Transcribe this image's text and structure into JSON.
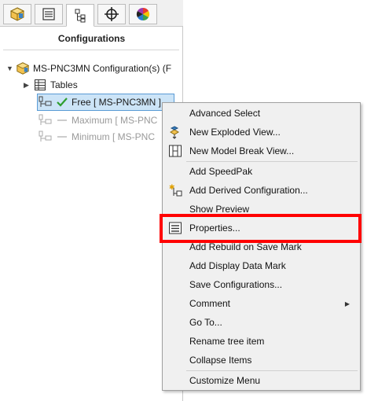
{
  "tabs": [
    {
      "name": "feature-manager",
      "icon": "part-cube-icon"
    },
    {
      "name": "property-manager",
      "icon": "property-list-icon"
    },
    {
      "name": "configuration-manager",
      "icon": "config-tree-icon",
      "active": true
    },
    {
      "name": "dimxpert-manager",
      "icon": "crosshair-icon"
    },
    {
      "name": "display-manager",
      "icon": "color-wheel-icon"
    }
  ],
  "panel": {
    "title": "Configurations"
  },
  "tree": {
    "root_label": "MS-PNC3MN Configuration(s)  (F",
    "tables_label": "Tables",
    "free_label": "Free [ MS-PNC3MN ]",
    "maximum_label": "Maximum [ MS-PNC",
    "minimum_label": "Minimum [ MS-PNC"
  },
  "menu": {
    "items": [
      {
        "label": "Advanced Select",
        "icon": ""
      },
      {
        "label": "New Exploded View...",
        "icon": "exploded-view-icon"
      },
      {
        "label": "New Model Break View...",
        "icon": "break-view-icon"
      },
      {
        "label": "Add SpeedPak",
        "icon": ""
      },
      {
        "label": "Add Derived Configuration...",
        "icon": "derived-config-icon"
      },
      {
        "label": "Show Preview",
        "icon": ""
      },
      {
        "label": "Properties...",
        "icon": "properties-icon"
      },
      {
        "label": "Add Rebuild on Save Mark",
        "icon": ""
      },
      {
        "label": "Add Display Data Mark",
        "icon": ""
      },
      {
        "label": "Save Configurations...",
        "icon": ""
      },
      {
        "label": "Comment",
        "icon": "",
        "submenu": true
      },
      {
        "label": "Go To...",
        "icon": ""
      },
      {
        "label": "Rename tree item",
        "icon": ""
      },
      {
        "label": "Collapse Items",
        "icon": ""
      },
      {
        "label": "Customize Menu",
        "icon": ""
      }
    ]
  },
  "colors": {
    "highlight": "#ff0000",
    "selection": "#cce4f7",
    "check": "#2e9e2e",
    "menu_bg": "#f0f0f0"
  }
}
